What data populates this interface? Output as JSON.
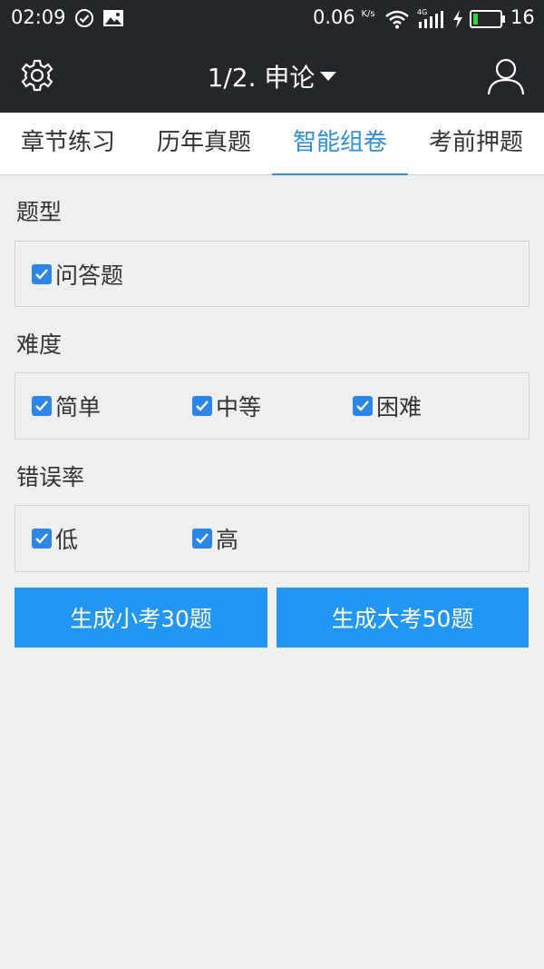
{
  "status_bar": {
    "time": "02:09",
    "speed": "0.06",
    "speed_unit": "K/s",
    "network": "4G",
    "battery": "16",
    "icons": [
      "check-circle-icon",
      "image-icon",
      "wifi-icon",
      "signal-icon",
      "charging-icon",
      "battery-icon"
    ]
  },
  "header": {
    "title": "1/2. 申论",
    "left_icon": "gear-icon",
    "right_icon": "user-icon"
  },
  "tabs": [
    {
      "label": "章节练习",
      "active": false
    },
    {
      "label": "历年真题",
      "active": false
    },
    {
      "label": "智能组卷",
      "active": true
    },
    {
      "label": "考前押题",
      "active": false
    }
  ],
  "sections": {
    "type": {
      "label": "题型",
      "options": [
        {
          "label": "问答题",
          "checked": true
        }
      ]
    },
    "difficulty": {
      "label": "难度",
      "options": [
        {
          "label": "简单",
          "checked": true
        },
        {
          "label": "中等",
          "checked": true
        },
        {
          "label": "困难",
          "checked": true
        }
      ]
    },
    "error_rate": {
      "label": "错误率",
      "options": [
        {
          "label": "低",
          "checked": true
        },
        {
          "label": "高",
          "checked": true
        }
      ]
    }
  },
  "buttons": {
    "small": "生成小考30题",
    "large": "生成大考50题"
  },
  "colors": {
    "bar": "#23272a",
    "accent": "#2f8fda",
    "button": "#2196f3",
    "checkbox": "#2b86e6"
  }
}
